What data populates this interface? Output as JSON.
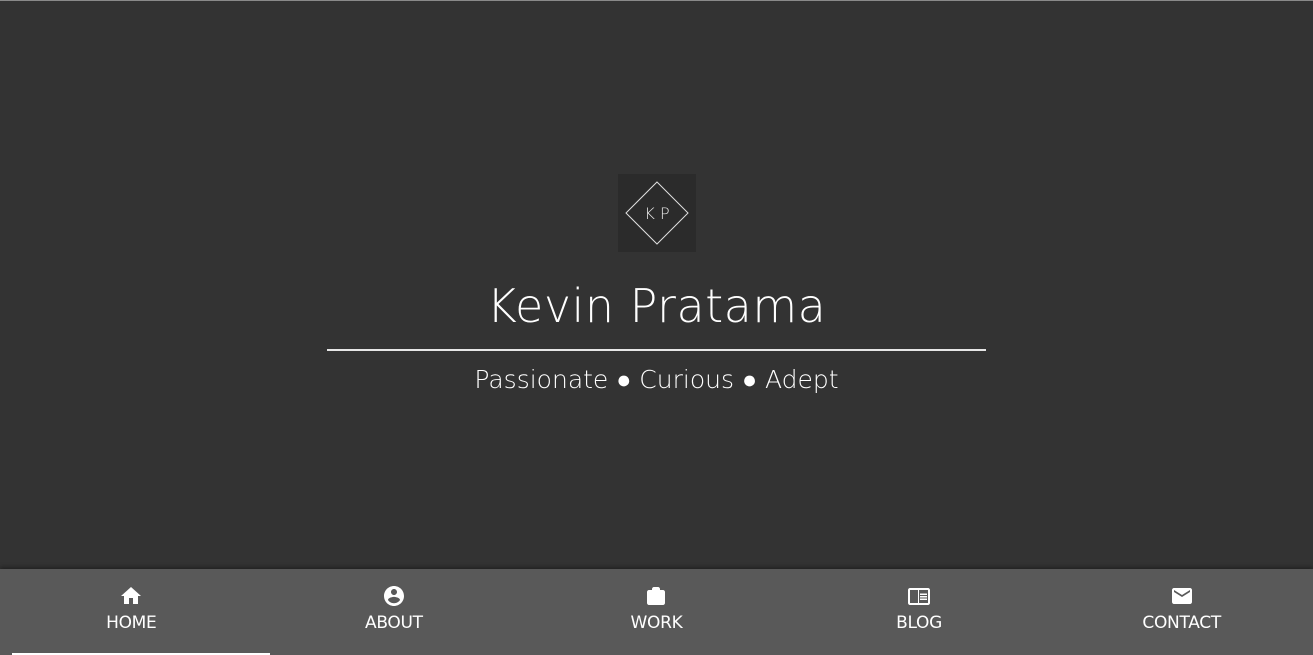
{
  "hero": {
    "logo_initials": "K P",
    "name": "Kevin Pratama",
    "tagline": "Passionate ● Curious ● Adept"
  },
  "nav": {
    "items": [
      {
        "label": "HOME",
        "icon": "home-icon",
        "active": true
      },
      {
        "label": "ABOUT",
        "icon": "account-circle-icon",
        "active": false
      },
      {
        "label": "WORK",
        "icon": "briefcase-icon",
        "active": false
      },
      {
        "label": "BLOG",
        "icon": "article-icon",
        "active": false
      },
      {
        "label": "CONTACT",
        "icon": "mail-icon",
        "active": false
      }
    ]
  },
  "colors": {
    "background": "#333333",
    "nav_background": "#595959",
    "text": "#ffffff"
  }
}
